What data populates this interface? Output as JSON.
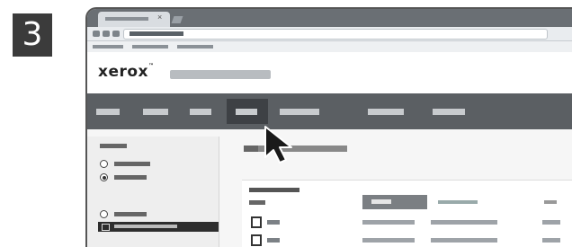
{
  "step": {
    "number": "3"
  },
  "browser": {
    "tab_title": "",
    "tab_close": "×",
    "address": ""
  },
  "app": {
    "logo_text": "xerox",
    "logo_mark": "™"
  },
  "nav": {
    "active_index": 3,
    "item_count": 7
  },
  "colors": {
    "menubar": "#5b5f63",
    "menu_active": "#3e4145",
    "badge": "#3b3b3b",
    "selected_sidebar": "#2d2d2d"
  },
  "icons": {
    "cursor": "pointer-arrow-icon",
    "tab_close": "close-icon",
    "row": "document-icon",
    "selected": "folder-icon"
  }
}
